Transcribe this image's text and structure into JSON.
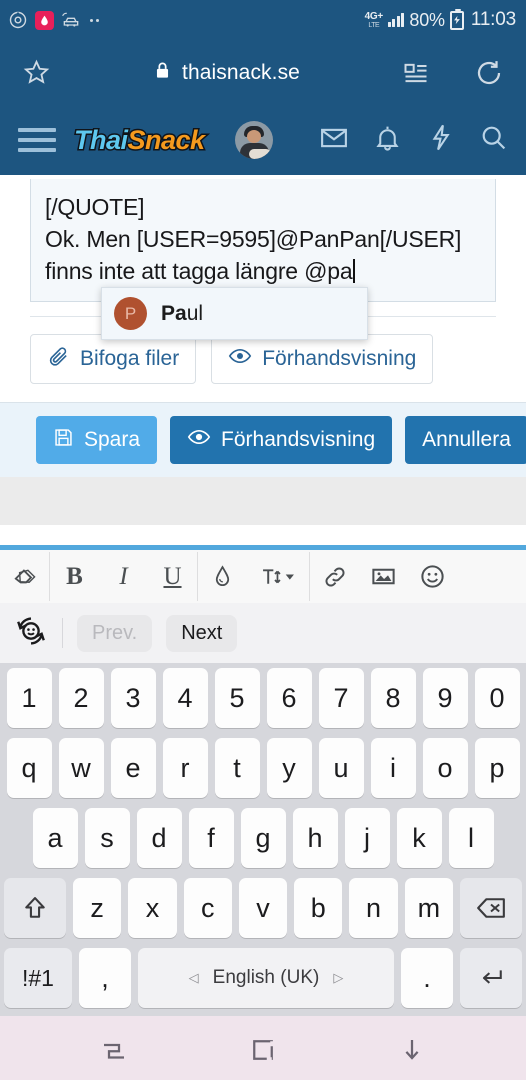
{
  "status_bar": {
    "icons": [
      "clock-circle-icon",
      "water-drop-badge-icon",
      "car-wifi-icon",
      "more-dots-icon"
    ],
    "network_type": "4G+",
    "network_sub": "LTE",
    "battery_percent": "80%",
    "time": "11:03"
  },
  "browser": {
    "bookmark_icon": "star-icon",
    "lock_icon": "lock-icon",
    "url": "thaisnack.se",
    "reader_icon": "reader-view-icon",
    "reload_icon": "reload-icon"
  },
  "site_header": {
    "menu_icon": "hamburger-menu-icon",
    "logo_part1": "Thai",
    "logo_part2": "Snack",
    "logo_color1": "#5ec8ef",
    "logo_color2": "#f59a1e",
    "avatar_label": "user-avatar",
    "icons": [
      "mail-icon",
      "bell-icon",
      "lightning-icon",
      "search-icon"
    ]
  },
  "editor": {
    "lines": [
      "[/QUOTE]",
      "Ok. Men [USER=9595]@PanPan[/USER]",
      "finns inte att tagga längre @pa"
    ]
  },
  "autocomplete": {
    "avatar_initial": "P",
    "avatar_color": "#b0512f",
    "match": "Pa",
    "rest": "ul"
  },
  "attach_row": {
    "attach_label": "Bifoga filer",
    "attach_icon": "paperclip-icon",
    "preview_label": "Förhandsvisning",
    "preview_icon": "eye-icon"
  },
  "action_bar": {
    "save_label": "Spara",
    "save_icon": "floppy-disk-icon",
    "save_color": "#51abe8",
    "preview_label": "Förhandsvisning",
    "preview_icon": "eye-icon",
    "cancel_label": "Annullera",
    "button_color": "#2273ae"
  },
  "format_toolbar": {
    "accent_color": "#52a8dd",
    "buttons": [
      {
        "name": "remove-format-icon",
        "glyph": "◇"
      },
      {
        "name": "bold-button",
        "glyph": "B"
      },
      {
        "name": "italic-button",
        "glyph": "I"
      },
      {
        "name": "underline-button",
        "glyph": "U"
      },
      {
        "name": "text-color-icon",
        "glyph": "◆"
      },
      {
        "name": "font-size-icon",
        "glyph": "T"
      },
      {
        "name": "link-icon",
        "glyph": "⚭"
      },
      {
        "name": "image-icon",
        "glyph": "▣"
      },
      {
        "name": "emoji-icon",
        "glyph": "☺"
      }
    ]
  },
  "keyboard": {
    "suggestion_bar": {
      "emoji_cycle_icon": "emoji-cycle-icon",
      "prev_label": "Prev.",
      "next_label": "Next"
    },
    "row1": [
      "1",
      "2",
      "3",
      "4",
      "5",
      "6",
      "7",
      "8",
      "9",
      "0"
    ],
    "row2": [
      "q",
      "w",
      "e",
      "r",
      "t",
      "y",
      "u",
      "i",
      "o",
      "p"
    ],
    "row3": [
      "a",
      "s",
      "d",
      "f",
      "g",
      "h",
      "j",
      "k",
      "l"
    ],
    "row4_shift": "shift-icon",
    "row4": [
      "z",
      "x",
      "c",
      "v",
      "b",
      "n",
      "m"
    ],
    "row4_backspace": "backspace-icon",
    "row5": {
      "symbols_label": "!#1",
      "comma_label": ",",
      "space_left_arrow": "◁",
      "space_label": "English (UK)",
      "space_right_arrow": "▷",
      "period_label": ".",
      "enter_icon": "enter-icon"
    }
  },
  "nav_bar": {
    "recents_icon": "recents-icon",
    "home_icon": "home-icon",
    "hide-keyboard_icon": "hide-keyboard-icon",
    "background": "#f0e4ec"
  }
}
